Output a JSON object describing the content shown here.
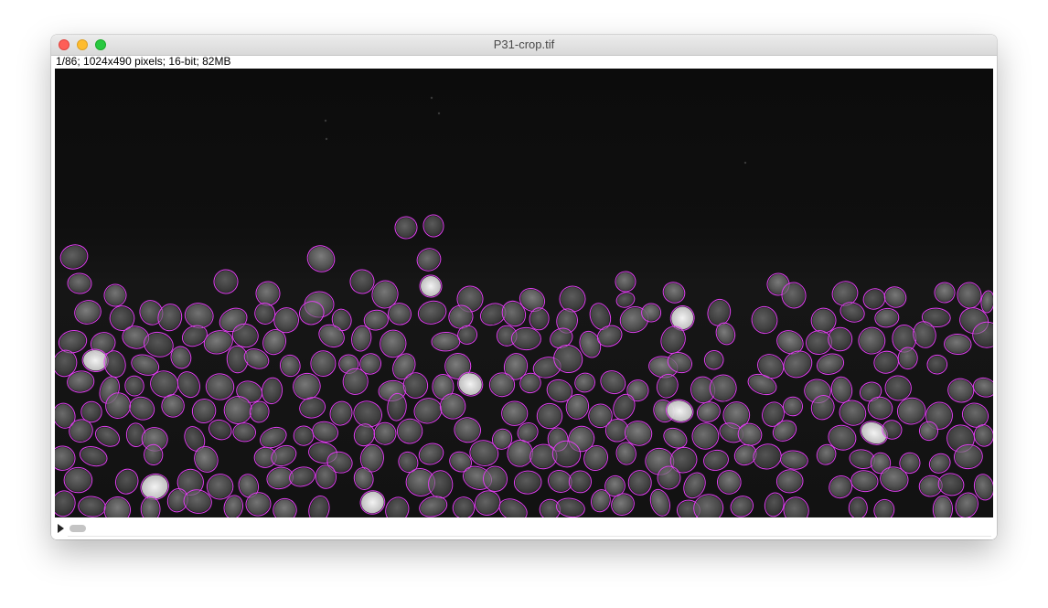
{
  "window": {
    "title": "P31-crop.tif",
    "info": "1/86; 1024x490 pixels; 16-bit; 82MB"
  },
  "image": {
    "roi_color": "#e040f0",
    "background": "#000000"
  },
  "stack": {
    "current_slice": 1,
    "total_slices": 86
  }
}
